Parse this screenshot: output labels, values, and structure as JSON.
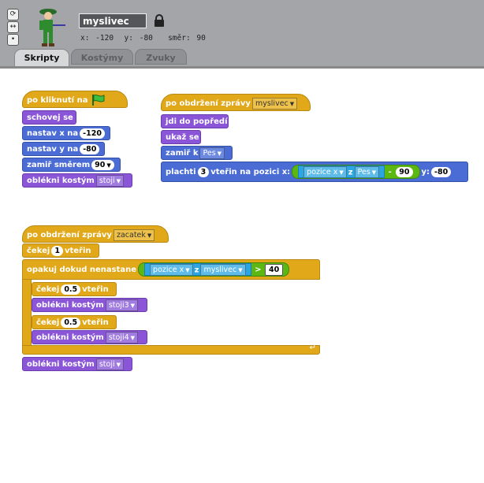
{
  "sprite": {
    "name": "myslivec",
    "x_label": "x:",
    "x_value": "-120",
    "y_label": "y:",
    "y_value": "-80",
    "direction_label": "směr:",
    "direction_value": "90"
  },
  "tabs": [
    {
      "label": "Skripty",
      "active": true
    },
    {
      "label": "Kostýmy",
      "active": false
    },
    {
      "label": "Zvuky",
      "active": false
    }
  ],
  "script1": {
    "hat": "po kliknutí na",
    "hide": "schovej se",
    "set_x": "nastav x na",
    "set_x_val": "-120",
    "set_y": "nastav y na",
    "set_y_val": "-80",
    "point_dir": "zamiř směrem",
    "point_dir_val": "90",
    "costume": "oblékni kostým",
    "costume_val": "stoji"
  },
  "script2": {
    "hat": "po obdržení zprávy",
    "hat_msg": "myslivec",
    "front": "jdi do popředí",
    "show": "ukaž se",
    "point_to": "zamiř k",
    "point_to_val": "Pes",
    "glide_a": "plachti",
    "glide_secs": "3",
    "glide_b": "vteřin na pozici x:",
    "pos_x": "pozice x",
    "of": "z",
    "of_sprite": "Pes",
    "minus": "-",
    "minus_val": "90",
    "y_label": "y:",
    "y_val": "-80"
  },
  "script3": {
    "hat": "po obdržení zprávy",
    "hat_msg": "zacatek",
    "wait": "čekej",
    "wait_val": "1",
    "secs": "vteřin",
    "repeat": "opakuj dokud nenastane",
    "pos_x": "pozice x",
    "of": "z",
    "of_sprite": "myslivec",
    "gt": ">",
    "gt_val": "40",
    "wait1_val": "0.5",
    "costume1": "oblékni kostým",
    "costume1_val": "stoji3",
    "wait2_val": "0.5",
    "costume2": "oblékni kostým",
    "costume2_val": "stoji4",
    "costume3": "oblékni kostým",
    "costume3_val": "stoji"
  }
}
